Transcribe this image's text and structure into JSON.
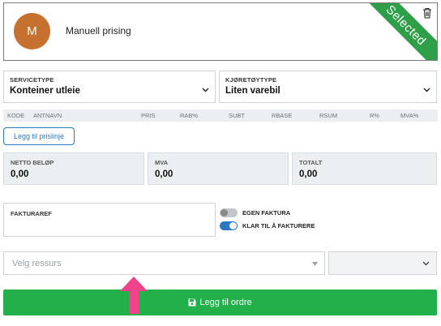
{
  "card": {
    "avatar_initial": "M",
    "title": "Manuell prising",
    "ribbon": "Selected",
    "ribbon_color": "#2e9e48",
    "avatar_color": "#c6712f"
  },
  "service": {
    "label": "SERVICETYPE",
    "value": "Konteiner utleie"
  },
  "vehicle": {
    "label": "KJØRETØYTYPE",
    "value": "Liten varebil"
  },
  "columns": [
    "KODE",
    "ANTNAVN",
    "PRIS",
    "RAB%",
    "SUBT",
    "RBASE",
    "RSUM",
    "R%",
    "MVA%"
  ],
  "add_line_label": "Legg til prislinje",
  "totals": {
    "netto": {
      "label": "NETTO BELØP",
      "value": "0,00"
    },
    "mva": {
      "label": "MVA",
      "value": "0,00"
    },
    "totalt": {
      "label": "TOTALT",
      "value": "0,00"
    }
  },
  "fakturaref": {
    "label": "FAKTURAREF"
  },
  "toggles": {
    "egen": {
      "label": "EGEN FAKTURA",
      "on": false
    },
    "klar": {
      "label": "KLAR TIL Å FAKTURERE",
      "on": true
    }
  },
  "resource": {
    "placeholder": "Velg ressurs"
  },
  "order_button": {
    "label": "Legg til ordre",
    "color": "#22b04b"
  },
  "accent_color": "#2b79c2",
  "arrow_color": "#f0438c"
}
